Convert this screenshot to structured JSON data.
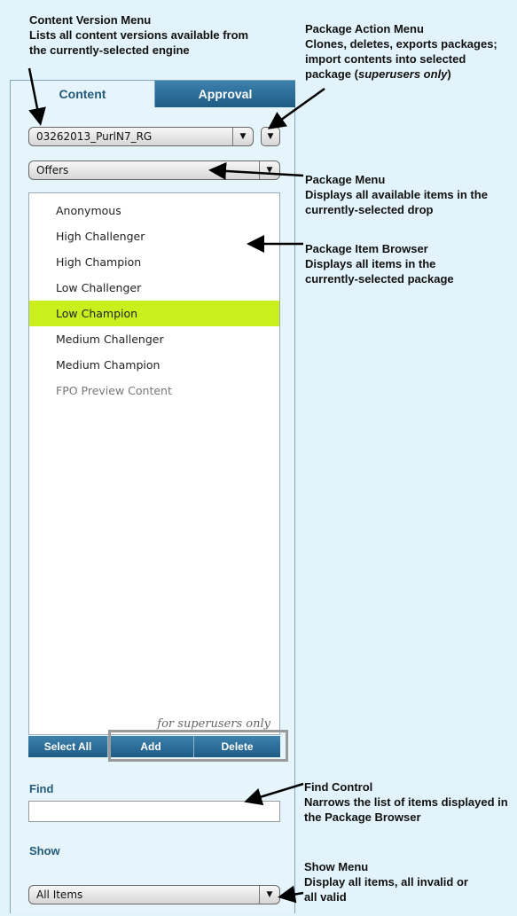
{
  "callouts": {
    "content_version": {
      "title": "Content Version Menu",
      "desc": "Lists all content versions available from the currently-selected engine"
    },
    "package_action": {
      "title": "Package Action Menu",
      "desc_prefix": "Clones, deletes, exports packages; import contents into selected package (",
      "desc_em": "superusers only",
      "desc_suffix": ")"
    },
    "package_menu": {
      "title": "Package Menu",
      "desc": "Displays all available items in the currently-selected drop"
    },
    "item_browser": {
      "title": "Package Item Browser",
      "desc": "Displays all items in the currently-selected package"
    },
    "find_control": {
      "title": "Find Control",
      "desc": "Narrows the list of items displayed in the Package Browser"
    },
    "show_menu": {
      "title": "Show Menu",
      "desc": "Display all items, all invalid or all valid"
    }
  },
  "tabs": {
    "content": "Content",
    "approval": "Approval"
  },
  "version_select": {
    "value": "03262013_PurlN7_RG"
  },
  "package_select": {
    "value": "Offers"
  },
  "items": [
    {
      "label": "Anonymous",
      "state": "normal"
    },
    {
      "label": "High Challenger",
      "state": "normal"
    },
    {
      "label": "High Champion",
      "state": "normal"
    },
    {
      "label": "Low Challenger",
      "state": "normal"
    },
    {
      "label": "Low Champion",
      "state": "selected"
    },
    {
      "label": "Medium Challenger",
      "state": "normal"
    },
    {
      "label": "Medium Champion",
      "state": "normal"
    },
    {
      "label": "FPO Preview Content",
      "state": "muted"
    }
  ],
  "superuser_note": "for superusers only",
  "buttons": {
    "select_all": "Select All",
    "add": "Add",
    "delete": "Delete"
  },
  "find": {
    "label": "Find",
    "value": ""
  },
  "show": {
    "label": "Show",
    "value": "All Items"
  },
  "icons": {
    "dropdown": "chevron-down-icon"
  },
  "colors": {
    "selected": "#c9ef1c",
    "accent": "#1f5b85",
    "background": "#e3f3fb"
  }
}
